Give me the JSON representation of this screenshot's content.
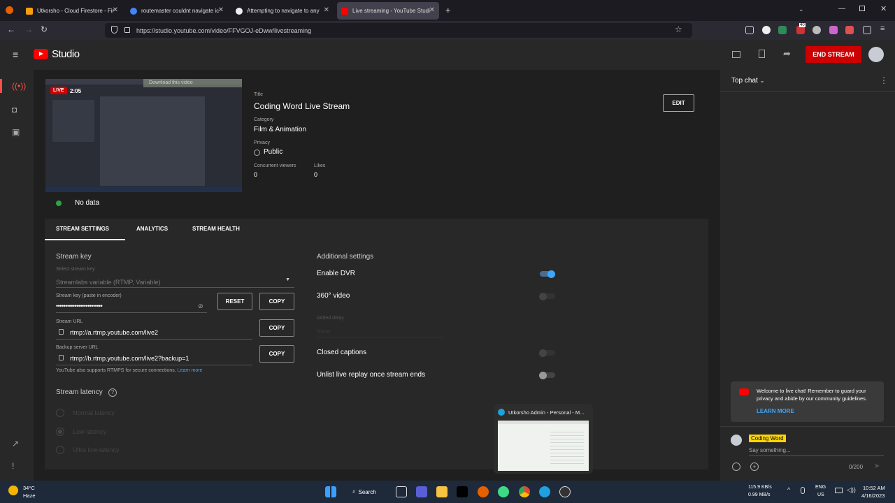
{
  "browser": {
    "tabs": [
      {
        "title": "Utkorsho - Cloud Firestore - Fir",
        "color": "#f7a00f"
      },
      {
        "title": "routemaster couldnt navigate ic",
        "color": "#4285f4"
      },
      {
        "title": "Attempting to navigate to any",
        "color": "#ffffff"
      },
      {
        "title": "Live streaming - YouTube Studi",
        "color": "#ff0000",
        "active": true
      }
    ],
    "url": "https://studio.youtube.com/video/FFVGOJ-eDww/livestreaming",
    "ext_badge": "40"
  },
  "header": {
    "studio_label": "Studio",
    "end_stream_label": "END STREAM"
  },
  "preview": {
    "live_label": "LIVE",
    "time": "2:05",
    "download_text": "Download this video"
  },
  "stream_info": {
    "title_label": "Title",
    "title_value": "Coding Word Live Stream",
    "category_label": "Category",
    "category_value": "Film & Animation",
    "privacy_label": "Privacy",
    "privacy_value": "Public",
    "viewers_label": "Concurrent viewers",
    "viewers_value": "0",
    "likes_label": "Likes",
    "likes_value": "0",
    "edit_label": "EDIT",
    "status_text": "No data"
  },
  "tabs": {
    "stream_settings": "STREAM SETTINGS",
    "analytics": "ANALYTICS",
    "stream_health": "STREAM HEALTH"
  },
  "stream_key": {
    "heading": "Stream key",
    "select_label": "Select stream key",
    "select_value": "Streamlabs variable (RTMP, Variable)",
    "key_label": "Stream key (paste in encoder)",
    "key_value": "•••••••••••••••••••••••••",
    "reset_label": "RESET",
    "copy_label": "COPY",
    "url_label": "Stream URL",
    "url_value": "rtmp://a.rtmp.youtube.com/live2",
    "backup_label": "Backup server URL",
    "backup_value": "rtmp://b.rtmp.youtube.com/live2?backup=1",
    "rtmps_note": "YouTube also supports RTMPS for secure connections.",
    "learn_more": "Learn more"
  },
  "latency": {
    "heading": "Stream latency",
    "options": [
      "Normal latency",
      "Low-latency",
      "Ultra low-latency"
    ]
  },
  "additional": {
    "heading": "Additional settings",
    "enable_dvr": "Enable DVR",
    "video360": "360° video",
    "added_delay_label": "Added delay",
    "added_delay_value": "None",
    "closed_captions": "Closed captions",
    "unlist_replay": "Unlist live replay once stream ends"
  },
  "chat": {
    "top_chat": "Top chat",
    "welcome_text": "Welcome to live chat! Remember to guard your privacy and abide by our community guidelines.",
    "learn_more": "LEARN MORE",
    "user_name": "Coding Word",
    "say_something": "Say something...",
    "counter": "0/200"
  },
  "thumbnail_popup": {
    "title": "Utkorsho Admin - Personal - M..."
  },
  "taskbar": {
    "weather_temp": "34°C",
    "weather_text": "Haze",
    "search_label": "Search",
    "net_up": "115.9 KB/s",
    "net_down": "0.99 MB/s",
    "lang": "ENG",
    "region": "US",
    "time": "10:52 AM",
    "date": "4/16/2023"
  }
}
